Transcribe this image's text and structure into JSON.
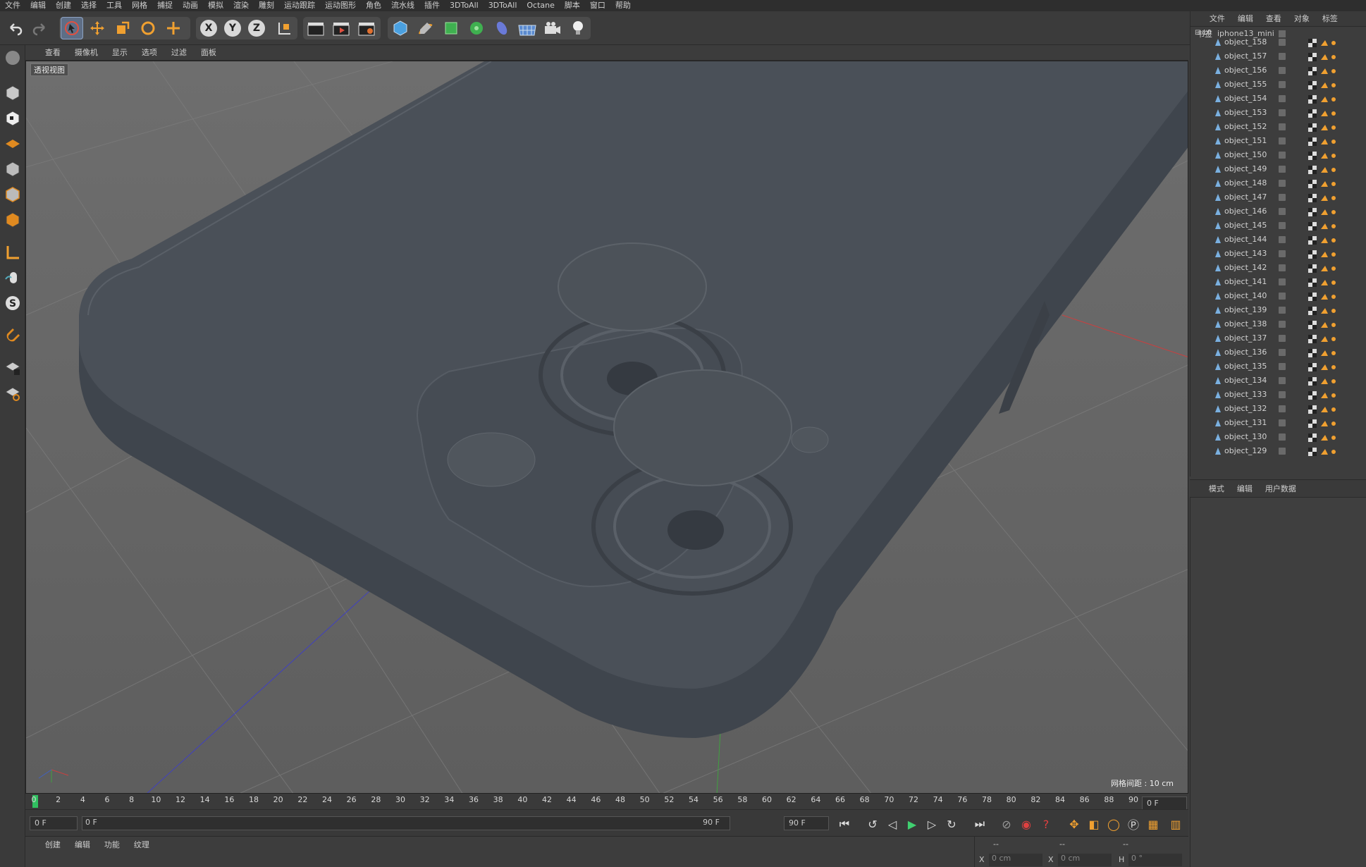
{
  "menubar": [
    "文件",
    "编辑",
    "创建",
    "选择",
    "工具",
    "网格",
    "捕捉",
    "动画",
    "模拟",
    "渲染",
    "雕刻",
    "运动跟踪",
    "运动图形",
    "角色",
    "流水线",
    "插件",
    "3DToAll",
    "3DToAll",
    "Octane",
    "脚本",
    "窗口",
    "帮助"
  ],
  "toolbar": {
    "axes": [
      "X",
      "Y",
      "Z"
    ]
  },
  "viewport": {
    "menu": [
      "查看",
      "摄像机",
      "显示",
      "选项",
      "过滤",
      "面板"
    ],
    "label": "透视视图",
    "grid_info": "网格间距 : 10 cm"
  },
  "timeline": {
    "ticks": [
      "0",
      "2",
      "4",
      "6",
      "8",
      "10",
      "12",
      "14",
      "16",
      "18",
      "20",
      "22",
      "24",
      "26",
      "28",
      "30",
      "32",
      "34",
      "36",
      "38",
      "40",
      "42",
      "44",
      "46",
      "48",
      "50",
      "52",
      "54",
      "56",
      "58",
      "60",
      "62",
      "64",
      "66",
      "68",
      "70",
      "72",
      "74",
      "76",
      "78",
      "80",
      "82",
      "84",
      "86",
      "88",
      "90"
    ],
    "current_frame": "0 F",
    "start_field": "0 F",
    "range_start": "0 F",
    "range_end": "90 F",
    "end_field": "90 F"
  },
  "material_panel": {
    "menu": [
      "创建",
      "编辑",
      "功能",
      "纹理"
    ]
  },
  "coord_panel": {
    "row1": [
      "--",
      "--",
      "--"
    ],
    "x_label": "X",
    "x_value": "0 cm",
    "x2_label": "X",
    "x2_value": "0 cm",
    "h_label": "H",
    "h_value": "0 °"
  },
  "object_manager": {
    "menu": [
      "文件",
      "编辑",
      "查看",
      "对象",
      "标签",
      "书签"
    ],
    "root": "iphone13_mini",
    "objects": [
      "object_158",
      "object_157",
      "object_156",
      "object_155",
      "object_154",
      "object_153",
      "object_152",
      "object_151",
      "object_150",
      "object_149",
      "object_148",
      "object_147",
      "object_146",
      "object_145",
      "object_144",
      "object_143",
      "object_142",
      "object_141",
      "object_140",
      "object_139",
      "object_138",
      "object_137",
      "object_136",
      "object_135",
      "object_134",
      "object_133",
      "object_132",
      "object_131",
      "object_130",
      "object_129"
    ]
  },
  "attribute_manager": {
    "menu": [
      "模式",
      "编辑",
      "用户数据"
    ]
  },
  "colors": {
    "accent": "#f0a030",
    "active_tool": "#5e6e86",
    "phone_body": "#4a5058"
  }
}
